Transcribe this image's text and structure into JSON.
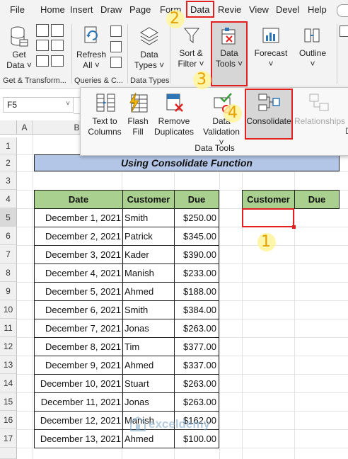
{
  "menu": {
    "items": [
      "File",
      "Home",
      "Insert",
      "Draw",
      "Page",
      "Form",
      "Data",
      "Review",
      "View",
      "Developer",
      "Help"
    ],
    "display": [
      "File",
      "Home",
      "Insert",
      "Draw",
      "Page",
      "Form",
      "Data",
      "Revie",
      "View",
      "Devel",
      "Help"
    ]
  },
  "ribbon": {
    "get_data": "Get\nData",
    "refresh_all": "Refresh\nAll",
    "data_types": "Data\nTypes",
    "sort_filter": "Sort &\nFilter",
    "data_tools": "Data\nTools",
    "forecast": "Forecast",
    "outline": "Outline",
    "group_get_transform": "Get & Transform...",
    "group_queries": "Queries & C...",
    "group_data_types": "Data Types"
  },
  "popup": {
    "text_to_columns": "Text to\nColumns",
    "flash_fill": "Flash\nFill",
    "remove_duplicates": "Remove\nDuplicates",
    "data_validation": "Data\nValidation",
    "consolidate": "Consolidate",
    "relationships": "Relationships",
    "group_label": "Data Tools"
  },
  "namebox": {
    "value": "F5"
  },
  "columns": [
    "A",
    "B"
  ],
  "rows": [
    "1",
    "2",
    "3",
    "4",
    "5",
    "6",
    "7",
    "8",
    "9",
    "10",
    "11",
    "12",
    "13",
    "14",
    "15",
    "16",
    "17"
  ],
  "title": "Using Consolidate Function",
  "table": {
    "headers": [
      "Date",
      "Customer",
      "Due"
    ],
    "rows": [
      [
        "December 1, 2021",
        "Smith",
        "$250.00"
      ],
      [
        "December 2, 2021",
        "Patrick",
        "$345.00"
      ],
      [
        "December 3, 2021",
        "Kader",
        "$390.00"
      ],
      [
        "December 4, 2021",
        "Manish",
        "$233.00"
      ],
      [
        "December 5, 2021",
        "Ahmed",
        "$188.00"
      ],
      [
        "December 6, 2021",
        "Smith",
        "$384.00"
      ],
      [
        "December 7, 2021",
        "Jonas",
        "$263.00"
      ],
      [
        "December 8, 2021",
        "Tim",
        "$377.00"
      ],
      [
        "December 9, 2021",
        "Ahmed",
        "$337.00"
      ],
      [
        "December 10, 2021",
        "Stuart",
        "$263.00"
      ],
      [
        "December 11, 2021",
        "Jonas",
        "$263.00"
      ],
      [
        "December 12, 2021",
        "Manish",
        "$162.00"
      ],
      [
        "December 13, 2021",
        "Ahmed",
        "$100.00"
      ]
    ]
  },
  "output_table": {
    "headers": [
      "Customer",
      "Due"
    ]
  },
  "steps": [
    "1",
    "2",
    "3",
    "4"
  ],
  "watermark": "exceldemy",
  "colors": {
    "accent_red": "#e0211f",
    "header_green": "#a9d08e",
    "title_blue": "#b4c6e7",
    "step_yellow": "#e6a100"
  }
}
